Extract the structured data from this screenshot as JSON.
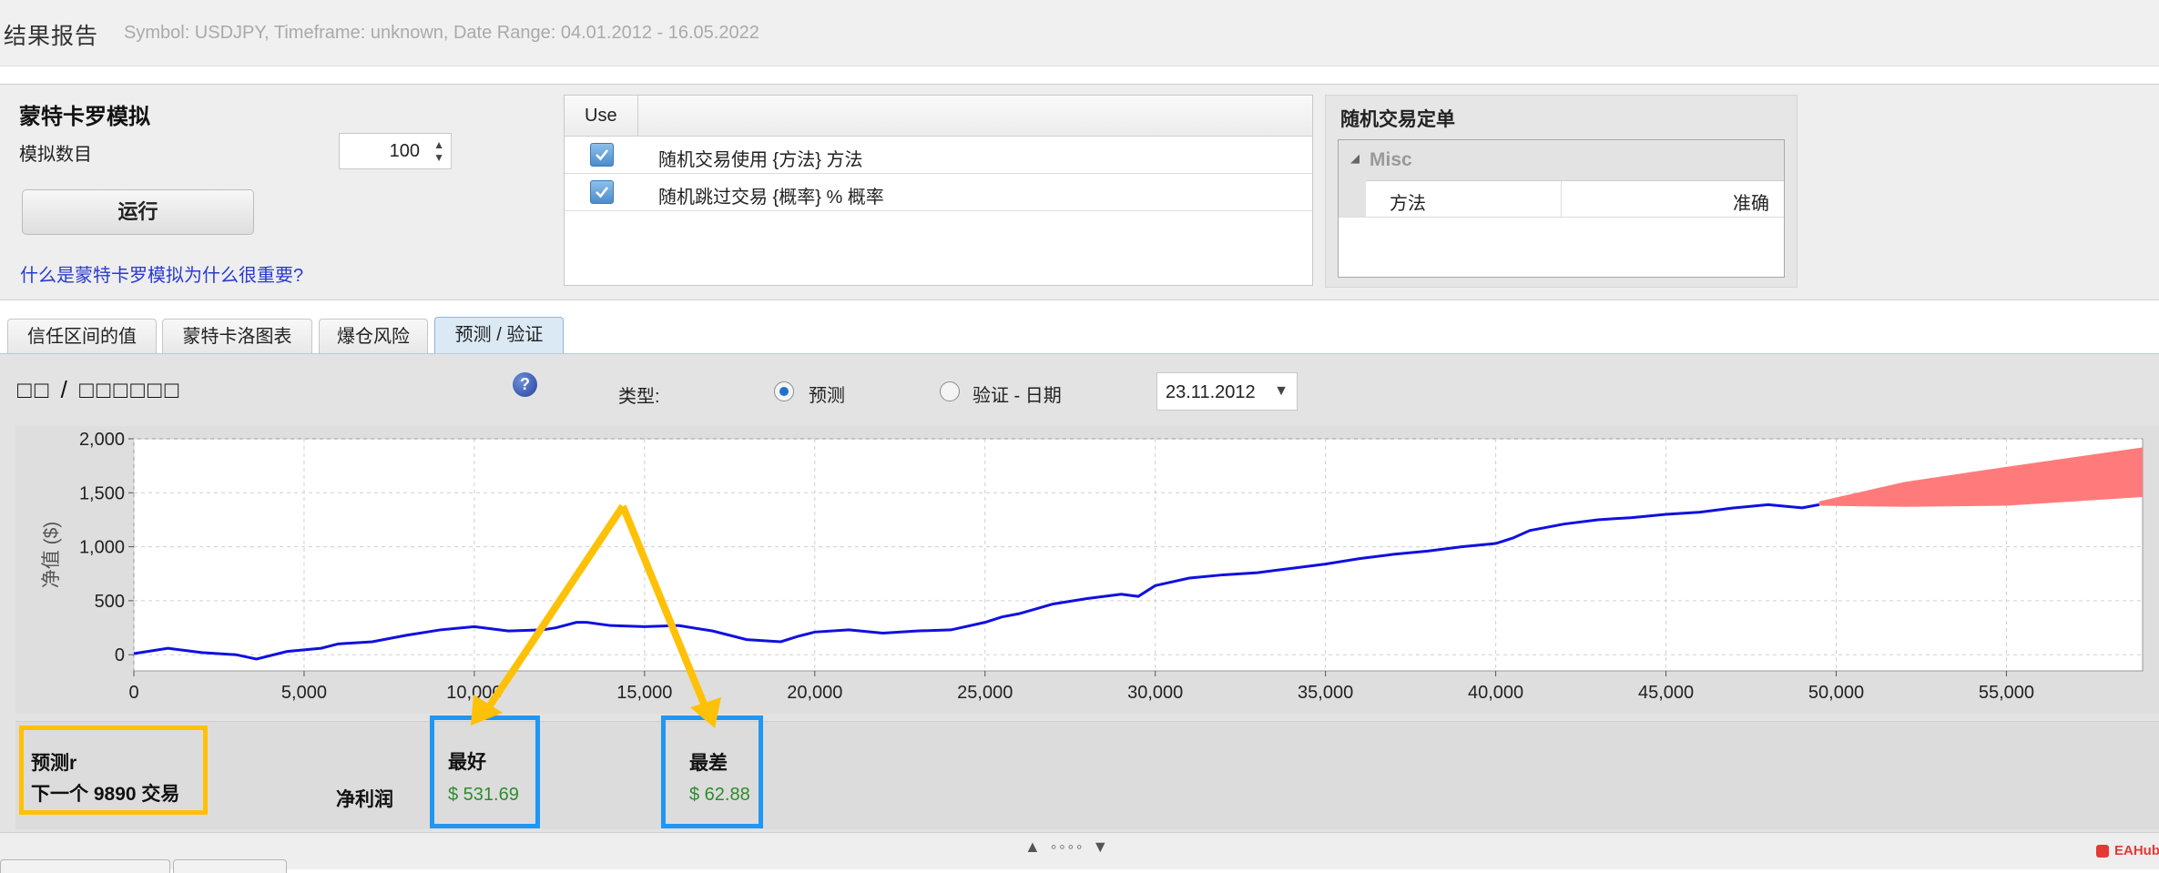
{
  "header": {
    "title": "结果报告",
    "subtitle": "Symbol: USDJPY, Timeframe: unknown, Date Range: 04.01.2012 - 16.05.2022"
  },
  "monte_carlo": {
    "title": "蒙特卡罗模拟",
    "count_label": "模拟数目",
    "count_value": "100",
    "run_label": "运行",
    "help_link": "什么是蒙特卡罗模拟为什么很重要?"
  },
  "use_table": {
    "header": "Use",
    "rows": [
      {
        "checked": true,
        "text": "随机交易使用 {方法} 方法"
      },
      {
        "checked": true,
        "text": "随机跳过交易 {概率} % 概率"
      }
    ]
  },
  "random_orders": {
    "title": "随机交易定单",
    "category": "Misc",
    "key": "方法",
    "value": "准确"
  },
  "tabs": [
    {
      "label": "信任区间的值",
      "active": false
    },
    {
      "label": "蒙特卡洛图表",
      "active": false
    },
    {
      "label": "爆仓风险",
      "active": false
    },
    {
      "label": "预测 / 验证",
      "active": true
    }
  ],
  "forecast_panel": {
    "title": "□□ / □□□□□□",
    "help_icon": "question-icon",
    "help_text": "?",
    "type_label": "类型:",
    "radio_forecast": "预测",
    "radio_validate": "验证 - 日期",
    "selected": "forecast",
    "date_value": "23.11.2012",
    "date_arrow": "▼"
  },
  "chart_data": {
    "type": "line",
    "ylabel": "净值 ($)",
    "xlabel": "",
    "xlim": [
      0,
      59000
    ],
    "ylim": [
      -150,
      2000
    ],
    "x_ticks": [
      "0",
      "5,000",
      "10,000",
      "15,000",
      "20,000",
      "25,000",
      "30,000",
      "35,000",
      "40,000",
      "45,000",
      "50,000",
      "55,000"
    ],
    "y_ticks": [
      "2,000",
      "1,500",
      "1,000",
      "500",
      "0"
    ],
    "grid": true,
    "series": [
      {
        "color": "#1010e0",
        "x": [
          0,
          1000,
          2000,
          3000,
          3600,
          4500,
          5500,
          6000,
          7000,
          8000,
          9000,
          10000,
          11000,
          12000,
          12400,
          13000,
          13300,
          14000,
          15000,
          16000,
          17000,
          18000,
          19000,
          19500,
          20000,
          21000,
          22000,
          23000,
          24000,
          25000,
          25500,
          26000,
          27000,
          28000,
          29000,
          29500,
          30000,
          31000,
          32000,
          33000,
          34000,
          35000,
          36000,
          37000,
          38000,
          39000,
          40000,
          40500,
          41000,
          42000,
          43000,
          44000,
          45000,
          46000,
          47000,
          48000,
          49000,
          49500
        ],
        "y": [
          10,
          60,
          20,
          0,
          -40,
          30,
          60,
          100,
          120,
          180,
          230,
          260,
          220,
          230,
          250,
          300,
          300,
          270,
          260,
          270,
          220,
          140,
          120,
          170,
          210,
          230,
          200,
          220,
          230,
          300,
          350,
          380,
          470,
          520,
          560,
          540,
          640,
          710,
          740,
          760,
          800,
          840,
          890,
          930,
          960,
          1000,
          1030,
          1080,
          1150,
          1210,
          1250,
          1270,
          1300,
          1320,
          1360,
          1390,
          1360,
          1390
        ]
      }
    ],
    "forecast_band": {
      "color": "#ff7b7b",
      "x": [
        49500,
        52000,
        55000,
        59000
      ],
      "upper": [
        1420,
        1600,
        1740,
        1920
      ],
      "lower": [
        1380,
        1370,
        1380,
        1460
      ]
    }
  },
  "summary": {
    "forecast_title": "预测r",
    "forecast_next": "下一个 9890 交易",
    "net_profit_label": "净利润",
    "best_title": "最好",
    "best_value": "$ 531.69",
    "worst_title": "最差",
    "worst_value": "$ 62.88"
  },
  "annotation_colors": {
    "yellow_box": "#ffc107",
    "blue_box": "#2196f3",
    "arrow": "#ffc107"
  },
  "bottom": {
    "splitter": "▲ ◦◦◦◦ ▼",
    "watermark": "EAHub"
  }
}
